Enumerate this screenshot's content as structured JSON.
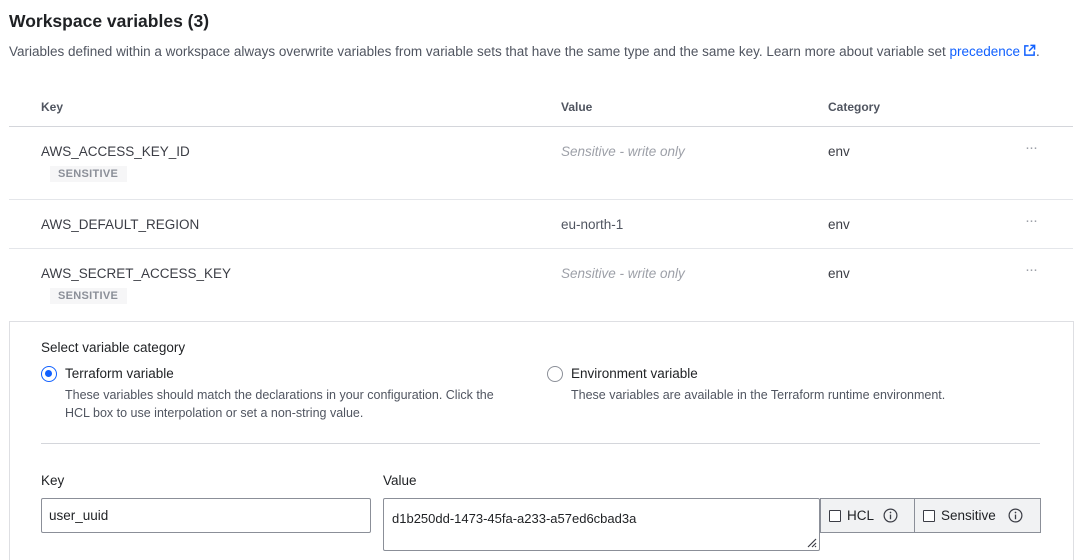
{
  "header": {
    "title": "Workspace variables (3)",
    "description": "Variables defined within a workspace always overwrite variables from variable sets that have the same type and the same key. Learn more about variable set ",
    "link_text": "precedence",
    "trailing": "."
  },
  "table": {
    "columns": [
      "Key",
      "Value",
      "Category"
    ],
    "rows": [
      {
        "key": "AWS_ACCESS_KEY_ID",
        "value": "Sensitive - write only",
        "category": "env",
        "badge": "SENSITIVE"
      },
      {
        "key": "AWS_DEFAULT_REGION",
        "value": "eu-north-1",
        "category": "env",
        "badge": ""
      },
      {
        "key": "AWS_SECRET_ACCESS_KEY",
        "value": "Sensitive - write only",
        "category": "env",
        "badge": "SENSITIVE"
      }
    ],
    "row_menu": "···"
  },
  "form": {
    "category_label": "Select variable category",
    "options": [
      {
        "label": "Terraform variable",
        "help_line1": "These variables should match the declarations in your configuration. Click the",
        "help_line2": "HCL box to use interpolation or set a non-string value.",
        "selected": true
      },
      {
        "label": "Environment variable",
        "help_line1": "These variables are available in the Terraform runtime environment.",
        "help_line2": "",
        "selected": false
      }
    ],
    "key_label": "Key",
    "key_value": "user_uuid",
    "value_label": "Value",
    "value_value": "d1b250dd-1473-45fa-a233-a57ed6cbad3a",
    "hcl_label": "HCL",
    "sensitive_label": "Sensitive"
  },
  "colors": {
    "accent": "#1060ff",
    "muted": "#9da0a8"
  },
  "icons": [
    "external-link-icon",
    "ellipsis-icon",
    "info-icon",
    "resize-handle-icon"
  ]
}
